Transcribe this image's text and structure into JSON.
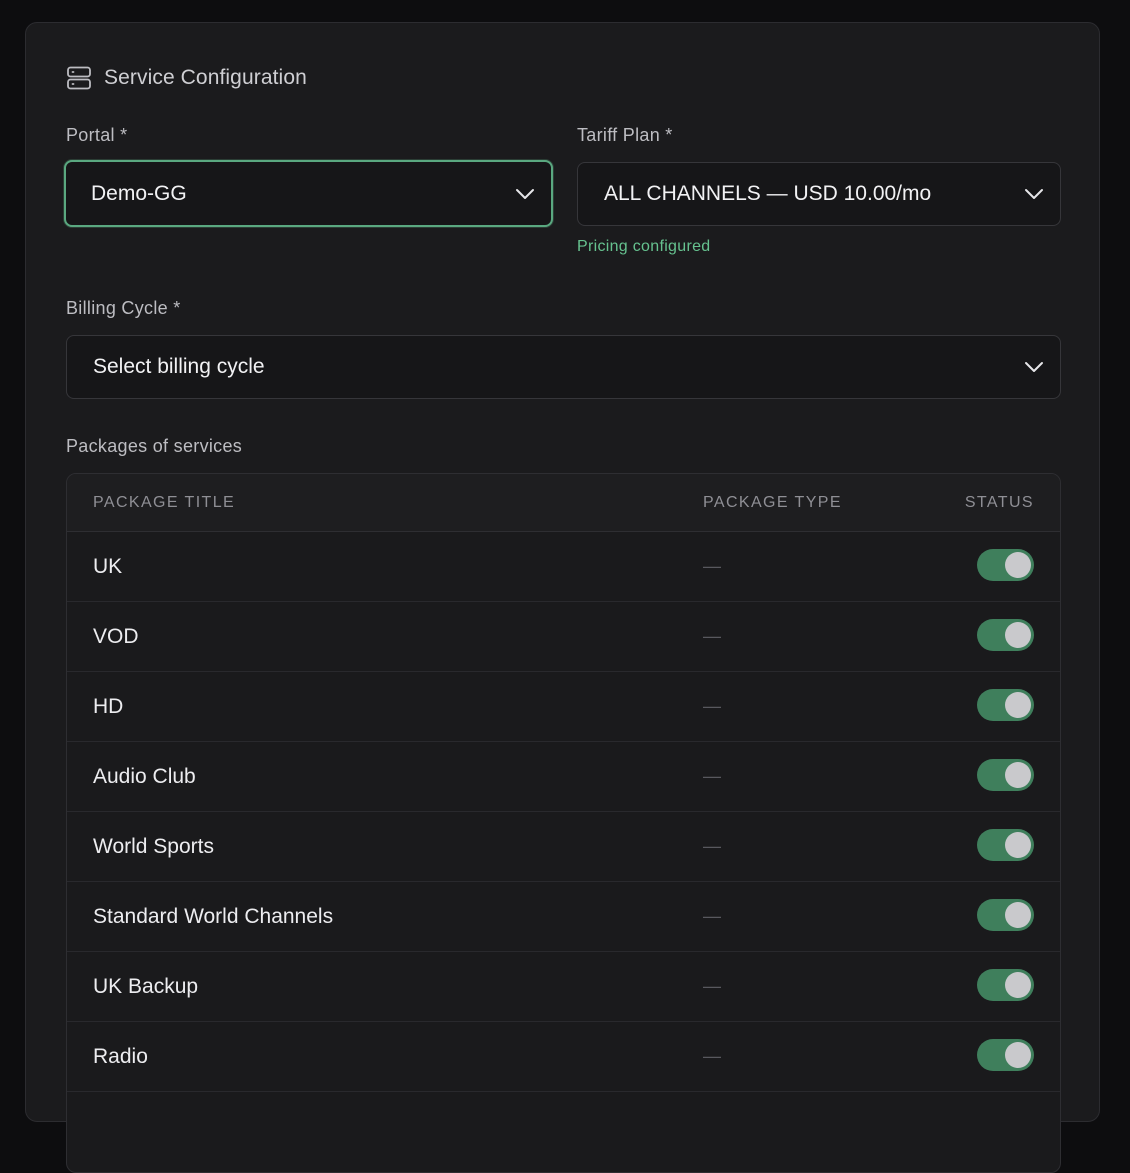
{
  "section": {
    "title": "Service Configuration",
    "icon": "server-icon"
  },
  "portal": {
    "label": "Portal *",
    "value": "Demo-GG"
  },
  "tariff": {
    "label": "Tariff Plan *",
    "value": "ALL CHANNELS — USD 10.00/mo",
    "hint": "Pricing configured"
  },
  "billing": {
    "label": "Billing Cycle *",
    "placeholder": "Select billing cycle"
  },
  "packages": {
    "label": "Packages of services",
    "columns": [
      "PACKAGE TITLE",
      "PACKAGE TYPE",
      "STATUS"
    ],
    "rows": [
      {
        "title": "UK",
        "type": "—",
        "enabled": true
      },
      {
        "title": "VOD",
        "type": "—",
        "enabled": true
      },
      {
        "title": "HD",
        "type": "—",
        "enabled": true
      },
      {
        "title": "Audio Club",
        "type": "—",
        "enabled": true
      },
      {
        "title": "World Sports",
        "type": "—",
        "enabled": true
      },
      {
        "title": "Standard World Channels",
        "type": "—",
        "enabled": true
      },
      {
        "title": "UK Backup",
        "type": "—",
        "enabled": true
      },
      {
        "title": "Radio",
        "type": "—",
        "enabled": true
      }
    ]
  },
  "colors": {
    "accent": "#5aa880",
    "toggle_on": "#3f7f5c",
    "hint": "#66c28f"
  }
}
